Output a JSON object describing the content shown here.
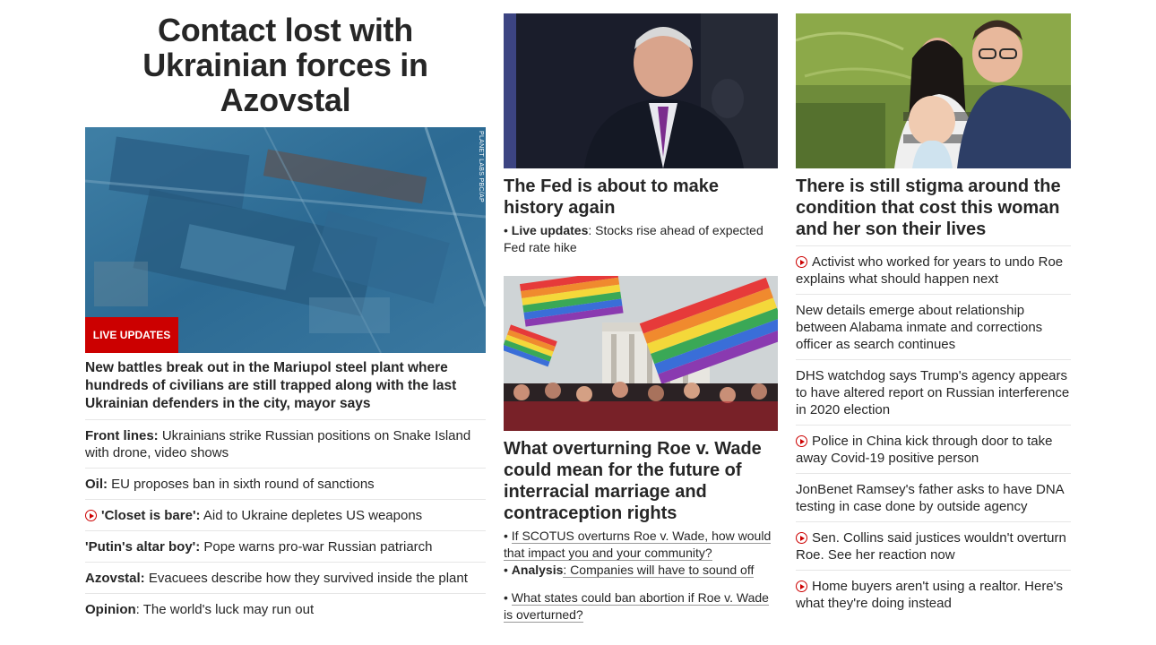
{
  "left": {
    "headline": "Contact lost with Ukrainian forces in Azovstal",
    "image_credit": "PLANET LABS PBC/AP",
    "live_badge": "LIVE UPDATES",
    "lead": "New battles break out in the Mariupol steel plant where hundreds of civilians are still trapped along with the last Ukrainian defenders in the city, mayor says",
    "items": [
      {
        "label": "Front lines:",
        "text": " Ukrainians strike Russian positions on Snake Island with drone, video shows",
        "video": false
      },
      {
        "label": "Oil:",
        "text": " EU proposes ban in sixth round of sanctions",
        "video": false
      },
      {
        "label": "'Closet is bare':",
        "text": " Aid to Ukraine depletes US weapons",
        "video": true
      },
      {
        "label": "'Putin's altar boy':",
        "text": " Pope warns pro-war Russian patriarch",
        "video": false
      },
      {
        "label": "Azovstal:",
        "text": " Evacuees describe how they survived inside the plant",
        "video": false
      },
      {
        "label": "Opinion",
        "text": ": The world's luck may run out",
        "video": false
      }
    ]
  },
  "middle": {
    "fed": {
      "title": "The Fed is about to make history again",
      "sub_label": "Live updates",
      "sub_text": ": Stocks rise ahead of expected Fed rate hike"
    },
    "roe": {
      "title": "What overturning Roe v. Wade could mean for the future of interracial marriage and contraception rights",
      "sub1": "If SCOTUS overturns Roe v. Wade, how would that impact you and your community?",
      "sub2_label": "Analysis",
      "sub2_text": ": Companies will have to sound off",
      "sub3": "What states could ban abortion if Roe v. Wade is overturned?"
    }
  },
  "right": {
    "title": "There is still stigma around the condition that cost this woman and her son their lives",
    "items": [
      {
        "text": "Activist who worked for years to undo Roe explains what should happen next",
        "video": true
      },
      {
        "text": "New details emerge about relationship between Alabama inmate and corrections officer as search continues",
        "video": false
      },
      {
        "text": "DHS watchdog says Trump's agency appears to have altered report on Russian interference in 2020 election",
        "video": false
      },
      {
        "text": "Police in China kick through door to take away Covid-19 positive person",
        "video": true
      },
      {
        "text": "JonBenet Ramsey's father asks to have DNA testing in case done by outside agency",
        "video": false
      },
      {
        "text": "Sen. Collins said justices wouldn't overturn Roe. See her reaction now",
        "video": true
      },
      {
        "text": "Home buyers aren't using a realtor. Here's what they're doing instead",
        "video": true
      }
    ]
  },
  "colors": {
    "accent": "#cc0000",
    "text": "#262626",
    "divider": "#e6e6e6"
  }
}
